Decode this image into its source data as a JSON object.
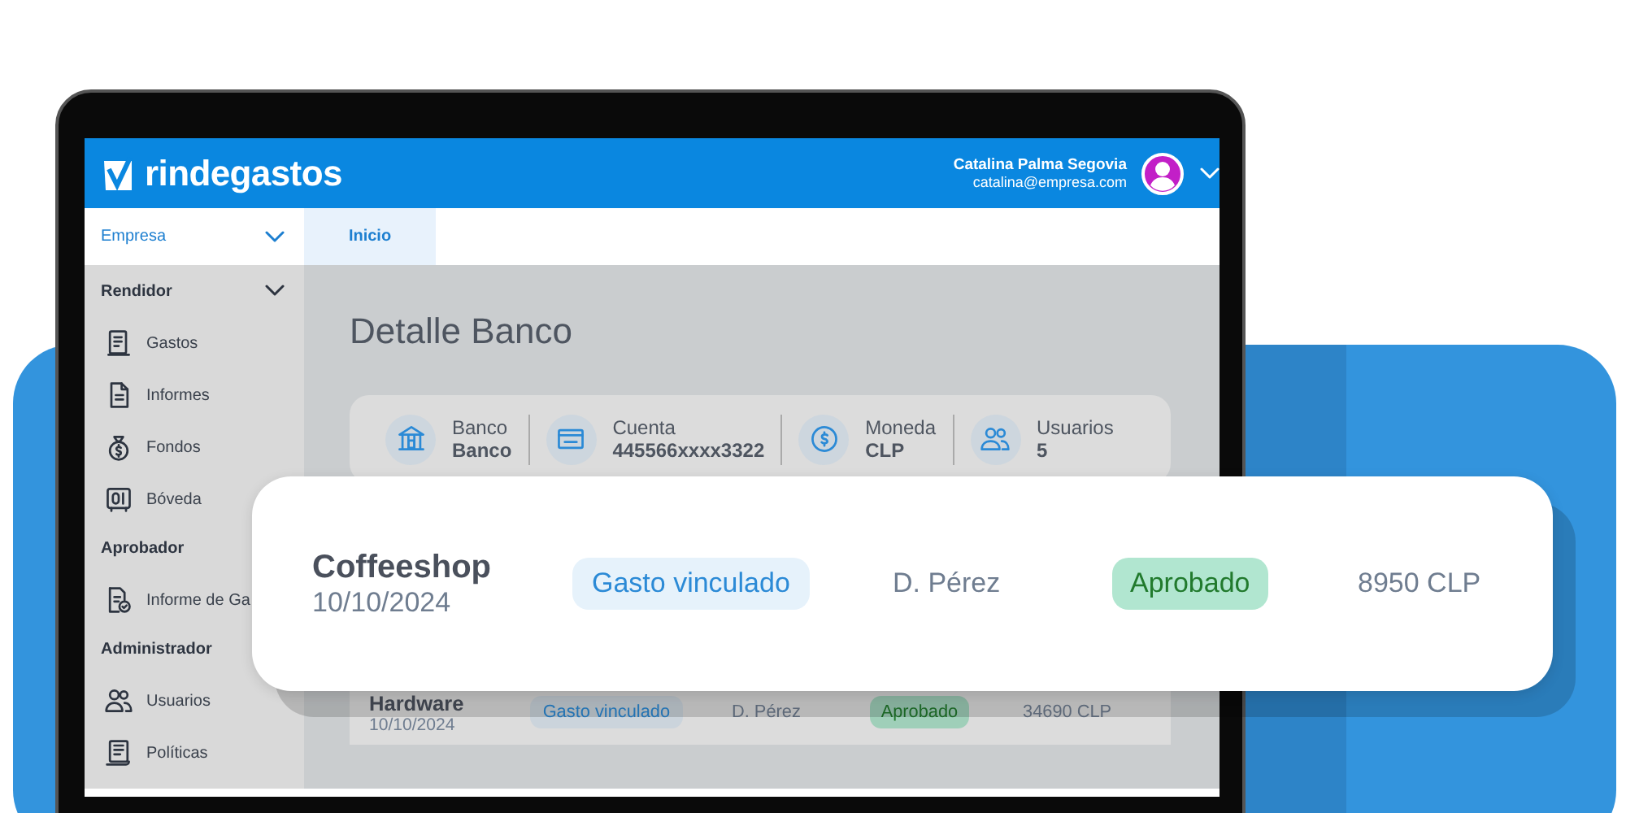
{
  "header": {
    "logo": "rindegastos",
    "user_name": "Catalina Palma Segovia",
    "user_email": "catalina@empresa.com"
  },
  "nav": {
    "company_select": "Empresa",
    "tabs": [
      {
        "label": "Inicio",
        "selected": true
      }
    ]
  },
  "sidebar": {
    "sections": [
      {
        "title": "Rendidor",
        "collapsible": true,
        "items": [
          "Gastos",
          "Informes",
          "Fondos",
          "Bóveda"
        ]
      },
      {
        "title": "Aprobador",
        "items": [
          "Informe de Ga"
        ]
      },
      {
        "title": "Administrador",
        "items": [
          "Usuarios",
          "Políticas"
        ]
      }
    ]
  },
  "page_title": "Detalle Banco",
  "summary": [
    {
      "label": "Banco",
      "value": "Banco"
    },
    {
      "label": "Cuenta",
      "value": "445566xxxx3322"
    },
    {
      "label": "Moneda",
      "value": "CLP"
    },
    {
      "label": "Usuarios",
      "value": "5"
    }
  ],
  "highlighted_row": {
    "name": "Coffeeshop",
    "date": "10/10/2024",
    "tag": "Gasto vinculado",
    "user": "D. Pérez",
    "status": "Aprobado",
    "amount": "8950 CLP"
  },
  "table": {
    "rows": [
      {
        "name": "Hardware",
        "date": "10/10/2024",
        "tag": "Gasto vinculado",
        "user": "D. Pérez",
        "status": "Aprobado",
        "amount": "34690 CLP"
      }
    ]
  }
}
